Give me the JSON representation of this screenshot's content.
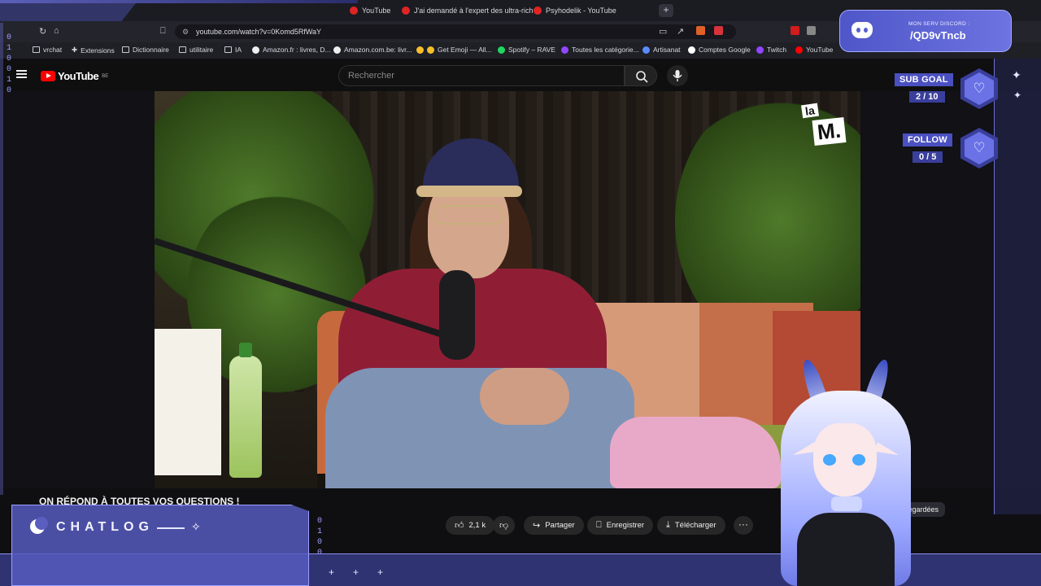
{
  "browser": {
    "tabs": [
      {
        "label": "YouTube",
        "active": false
      },
      {
        "label": "J'ai demandé à l'expert des ultra-rich",
        "active": false
      },
      {
        "label": "Psyhodelik - YouTube",
        "active": true
      }
    ],
    "new_tab_label": "+",
    "url": "youtube.com/watch?v=0Komd5RfWaY",
    "bookmarks": [
      {
        "label": "vrchat",
        "icon": "folder-icon"
      },
      {
        "label": "Extensions",
        "icon": "puzzle-icon"
      },
      {
        "label": "Dictionnaire",
        "icon": "folder-icon"
      },
      {
        "label": "utilitaire",
        "icon": "folder-icon"
      },
      {
        "label": "IA",
        "icon": "folder-icon"
      },
      {
        "label": "Amazon.fr : livres, D...",
        "icon": "amazon-icon"
      },
      {
        "label": "Amazon.com.be: livr...",
        "icon": "amazon-icon"
      },
      {
        "label": "Get Emoji — All...",
        "icon": "emoji-icon"
      },
      {
        "label": "Spotify – RAVE",
        "icon": "spotify-icon"
      },
      {
        "label": "Toutes les catégorie...",
        "icon": "twitch-icon"
      },
      {
        "label": "Artisanat",
        "icon": "artisanat-icon"
      },
      {
        "label": "Comptes Google",
        "icon": "google-icon"
      },
      {
        "label": "Twitch",
        "icon": "twitch-icon"
      },
      {
        "label": "YouTube",
        "icon": "youtube-icon"
      }
    ]
  },
  "youtube": {
    "logo_text": "YouTube",
    "region": "BE",
    "search_placeholder": "Rechercher",
    "watermark_line1": "la",
    "watermark_line2": "M.",
    "video_title": "ON RÉPOND À TOUTES VOS QUESTIONS !",
    "actions": {
      "likes": "2,1 k",
      "share": "Partager",
      "save": "Enregistrer",
      "download": "Télécharger",
      "more": "···"
    },
    "chips": {
      "watched": "Regardées"
    }
  },
  "overlay": {
    "discord_label": "MON SERV DISCORD :",
    "discord_code": "/QD9vTncb",
    "sub_goal_label": "SUB GOAL",
    "sub_goal_count": "2 / 10",
    "follow_label": "FOLLOW",
    "follow_count": "0 / 5",
    "chatlog_title": "CHATLOG",
    "binary_left": "0\n1\n0\n0\n1\n0",
    "binary_bottom": "0\n1\n0\n0"
  },
  "colors": {
    "accent": "#5a5fd0",
    "discord": "#5865f2",
    "youtube_red": "#ff0000"
  }
}
